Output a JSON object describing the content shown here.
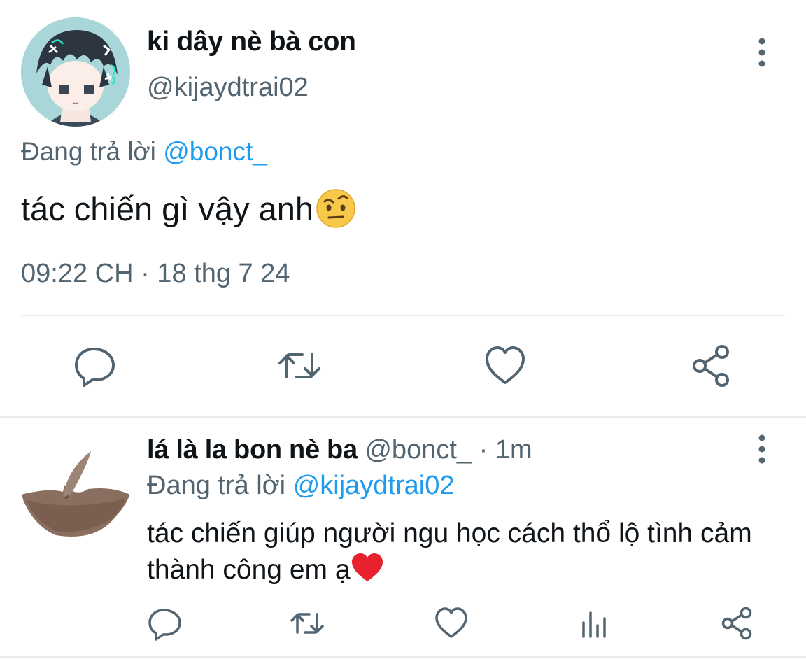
{
  "tweet": {
    "author_name": "ki dây nè bà con",
    "author_handle": "@kijaydtrai02",
    "replying_prefix": "Đang trả lời ",
    "replying_to": "@bonct_",
    "text": "tác chiến gì vậy anh",
    "emoji": "face-with-raised-eyebrow-emoji",
    "timestamp": "09:22 CH · 18 thg 7 24",
    "actions": [
      "reply-icon",
      "retweet-icon",
      "like-icon",
      "share-icon"
    ]
  },
  "reply": {
    "author_name": "lá là la bon nè ba",
    "author_handle": "@bonct_",
    "separator": " · ",
    "time": "1m",
    "replying_prefix": "Đang trả lời ",
    "replying_to": "@kijaydtrai02",
    "text": "tác chiến giúp người ngu học cách thổ lộ tình cảm thành công em ạ",
    "emoji": "red-heart-emoji",
    "actions": [
      "reply-icon",
      "retweet-icon",
      "like-icon",
      "views-icon",
      "share-icon"
    ]
  },
  "colors": {
    "text": "#0f1419",
    "secondary": "#536471",
    "link": "#1d9bf0",
    "divider": "#e7ebee"
  }
}
